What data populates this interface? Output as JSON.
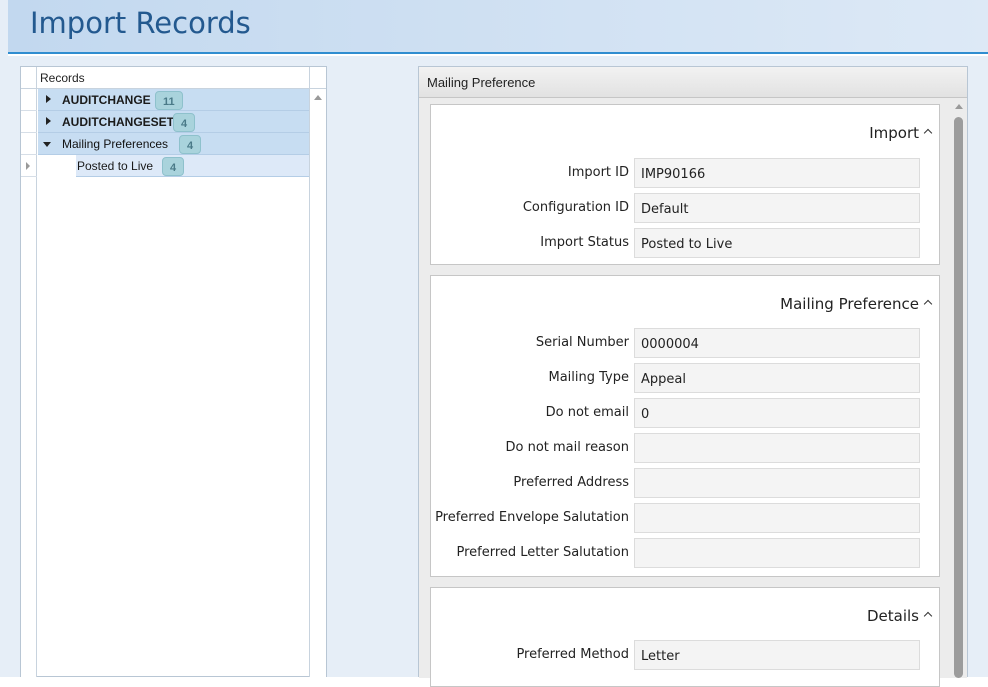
{
  "header": {
    "title": "Import Records"
  },
  "tree": {
    "column_label": "Records",
    "items": [
      {
        "label": "AUDITCHANGE",
        "count": "11"
      },
      {
        "label": "AUDITCHANGESET",
        "count": "4"
      },
      {
        "label": "Mailing Preferences",
        "count": "4"
      },
      {
        "label": "Posted to Live",
        "count": "4"
      }
    ]
  },
  "detail": {
    "title": "Mailing Preference",
    "sections": [
      {
        "title": "Import",
        "fields": [
          {
            "label": "Import ID",
            "value": "IMP90166"
          },
          {
            "label": "Configuration ID",
            "value": "Default"
          },
          {
            "label": "Import Status",
            "value": "Posted to Live"
          }
        ]
      },
      {
        "title": "Mailing Preference",
        "fields": [
          {
            "label": "Serial Number",
            "value": "0000004"
          },
          {
            "label": "Mailing Type",
            "value": "Appeal"
          },
          {
            "label": "Do not email",
            "value": "0"
          },
          {
            "label": "Do not mail reason",
            "value": ""
          },
          {
            "label": "Preferred Address",
            "value": ""
          },
          {
            "label": "Preferred Envelope Salutation",
            "value": ""
          },
          {
            "label": "Preferred Letter Salutation",
            "value": ""
          }
        ]
      },
      {
        "title": "Details",
        "fields": [
          {
            "label": "Preferred Method",
            "value": "Letter"
          }
        ]
      }
    ]
  }
}
